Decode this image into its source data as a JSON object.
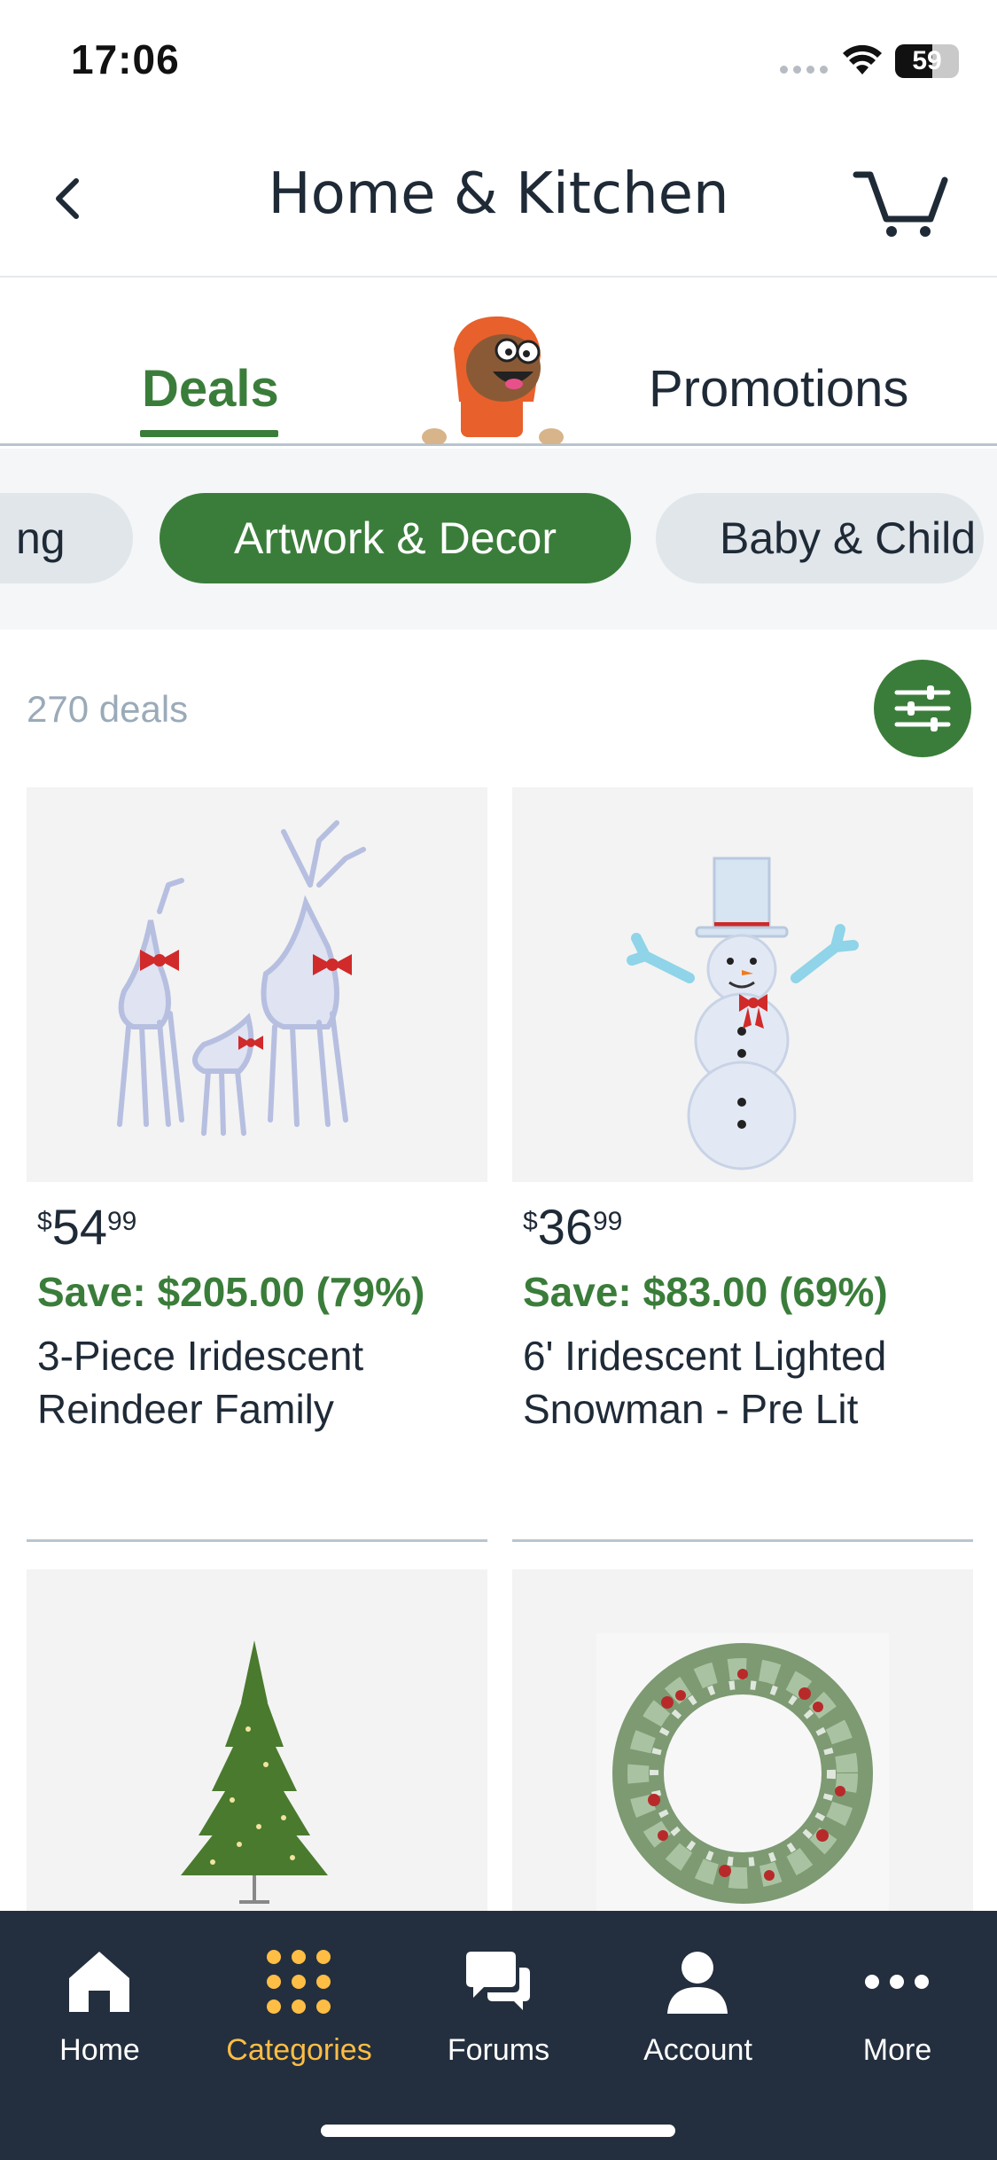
{
  "status": {
    "time": "17:06",
    "battery": "59",
    "battery_level": 0.59
  },
  "header": {
    "title": "Home & Kitchen",
    "back_icon": "chevron-left-icon",
    "cart_icon": "cart-icon"
  },
  "tabs": [
    {
      "label": "Deals",
      "active": true
    },
    {
      "label": "Promotions",
      "active": false
    }
  ],
  "categories": {
    "prev": "ng",
    "active": "Artwork & Decor",
    "next": "Baby & Child"
  },
  "deals_count": "270 deals",
  "products": [
    {
      "currency": "$",
      "whole": "54",
      "fraction": "99",
      "save": "Save: $205.00 (79%)",
      "name": "3-Piece Iridescent Reindeer Family",
      "image": "reindeer-image"
    },
    {
      "currency": "$",
      "whole": "36",
      "fraction": "99",
      "save": "Save: $83.00 (69%)",
      "name": "6' Iridescent Lighted Snowman - Pre Lit",
      "image": "snowman-image"
    },
    {
      "image": "christmas-tree-image"
    },
    {
      "image": "wreath-image"
    }
  ],
  "nav": [
    {
      "label": "Home",
      "icon": "home-icon",
      "active": false
    },
    {
      "label": "Categories",
      "icon": "grid-icon",
      "active": true
    },
    {
      "label": "Forums",
      "icon": "chat-icon",
      "active": false
    },
    {
      "label": "Account",
      "icon": "person-icon",
      "active": false
    },
    {
      "label": "More",
      "icon": "more-icon",
      "active": false
    }
  ],
  "colors": {
    "accent_green": "#3a7d3a",
    "nav_bg": "#232f3e",
    "nav_active": "#febd44",
    "chip_bg": "#e1e6ea"
  }
}
